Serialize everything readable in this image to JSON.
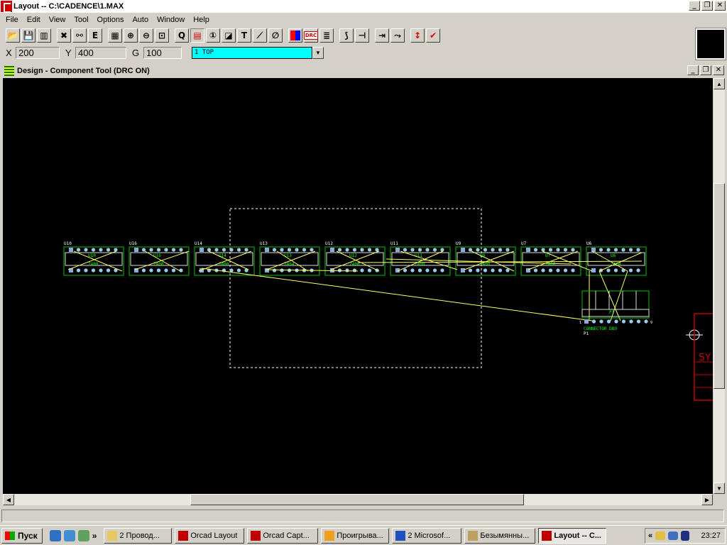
{
  "window": {
    "title": "Layout -- C:\\CADENCE\\1.MAX",
    "min_label": "_",
    "restore_label": "❐",
    "close_label": "✕"
  },
  "menu": [
    "File",
    "Edit",
    "View",
    "Tool",
    "Options",
    "Auto",
    "Window",
    "Help"
  ],
  "toolbar": {
    "icons": [
      "open-icon",
      "save-icon",
      "library-icon",
      "spacer",
      "component-manager-icon",
      "binoculars-icon",
      "e-icon",
      "spacer",
      "spreadsheet-icon",
      "zoom-in-icon",
      "zoom-out-icon",
      "zoom-all-icon",
      "spacer",
      "query-icon",
      "component-tool-icon",
      "pin-tool-icon",
      "obstacle-tool-icon",
      "text-tool-icon",
      "connection-tool-icon",
      "error-tool-icon",
      "spacer",
      "color-icon",
      "drc-box-icon",
      "reconnect-icon",
      "spacer",
      "add-track-icon",
      "edit-segment-icon",
      "spacer",
      "shove-track-icon",
      "auto-path-icon",
      "spacer",
      "refresh-drc-icon",
      "online-drc-icon"
    ],
    "drc_label": "DRC"
  },
  "coords": {
    "x_label": "X",
    "x_value": "200",
    "y_label": "Y",
    "y_value": "400",
    "g_label": "G",
    "g_value": "100",
    "layer": "1 TOP"
  },
  "child": {
    "title": "Design - Component Tool (DRC ON)"
  },
  "board": {
    "components": [
      {
        "ref": "U10",
        "name": "U10",
        "part": "7400"
      },
      {
        "ref": "U16",
        "name": "U16",
        "part": "7400"
      },
      {
        "ref": "U14",
        "name": "U14",
        "part": "7400"
      },
      {
        "ref": "U13",
        "name": "U13",
        "part": "7404"
      },
      {
        "ref": "U12",
        "name": "U12",
        "part": "7400"
      },
      {
        "ref": "U11",
        "name": "U11",
        "part": "7400"
      },
      {
        "ref": "U9",
        "name": "U9",
        "part": "7400"
      },
      {
        "ref": "U7",
        "name": "U7",
        "part": "7400"
      },
      {
        "ref": "U6",
        "name": "U6",
        "part": "7404"
      }
    ],
    "connector": {
      "name": "P1",
      "ref": "P1",
      "value": "CONNECTOR DB9",
      "pin1": "1",
      "pin9": "9"
    },
    "sym_label": "SY"
  },
  "taskbar": {
    "start": "Пуск",
    "tasks": [
      {
        "label": "2 Провод...",
        "icon_color": "#e8c860"
      },
      {
        "label": "Orcad Layout",
        "icon_color": "#c00000"
      },
      {
        "label": "Orcad Capt...",
        "icon_color": "#c00000"
      },
      {
        "label": "Проигрыва...",
        "icon_color": "#f0a020"
      },
      {
        "label": "2 Microsof...",
        "icon_color": "#2050c0"
      },
      {
        "label": "Безымянны...",
        "icon_color": "#c0a060"
      },
      {
        "label": "Layout -- C...",
        "icon_color": "#c00000",
        "active": true
      }
    ],
    "clock": "23:27"
  }
}
